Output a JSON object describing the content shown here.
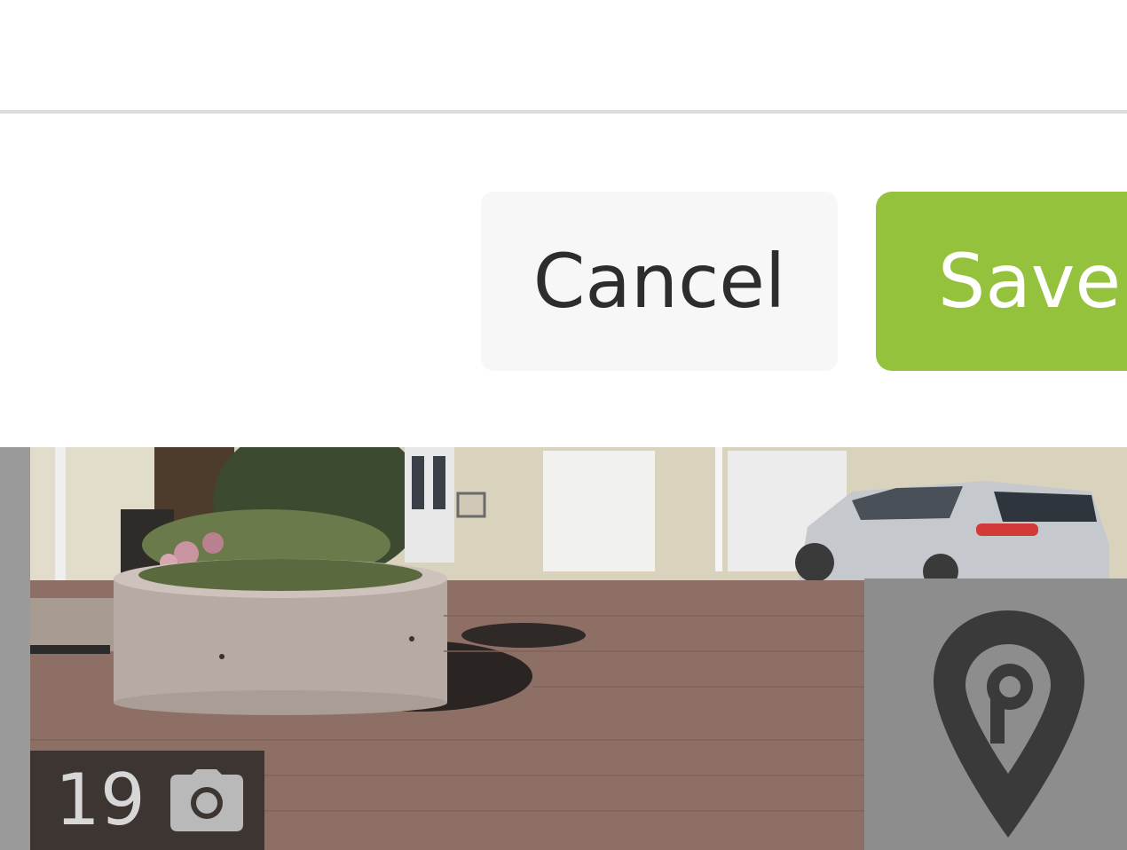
{
  "actions": {
    "cancel_label": "Cancel",
    "save_label": "Save S"
  },
  "listing": {
    "photo_count": "19",
    "camera_icon": "camera-icon",
    "map_icon": "map-pin-icon"
  },
  "colors": {
    "save_button": "#94c23c",
    "cancel_button": "#f7f7f7",
    "divider": "#dcdcdc",
    "overlay_dark": "#3d3532"
  }
}
